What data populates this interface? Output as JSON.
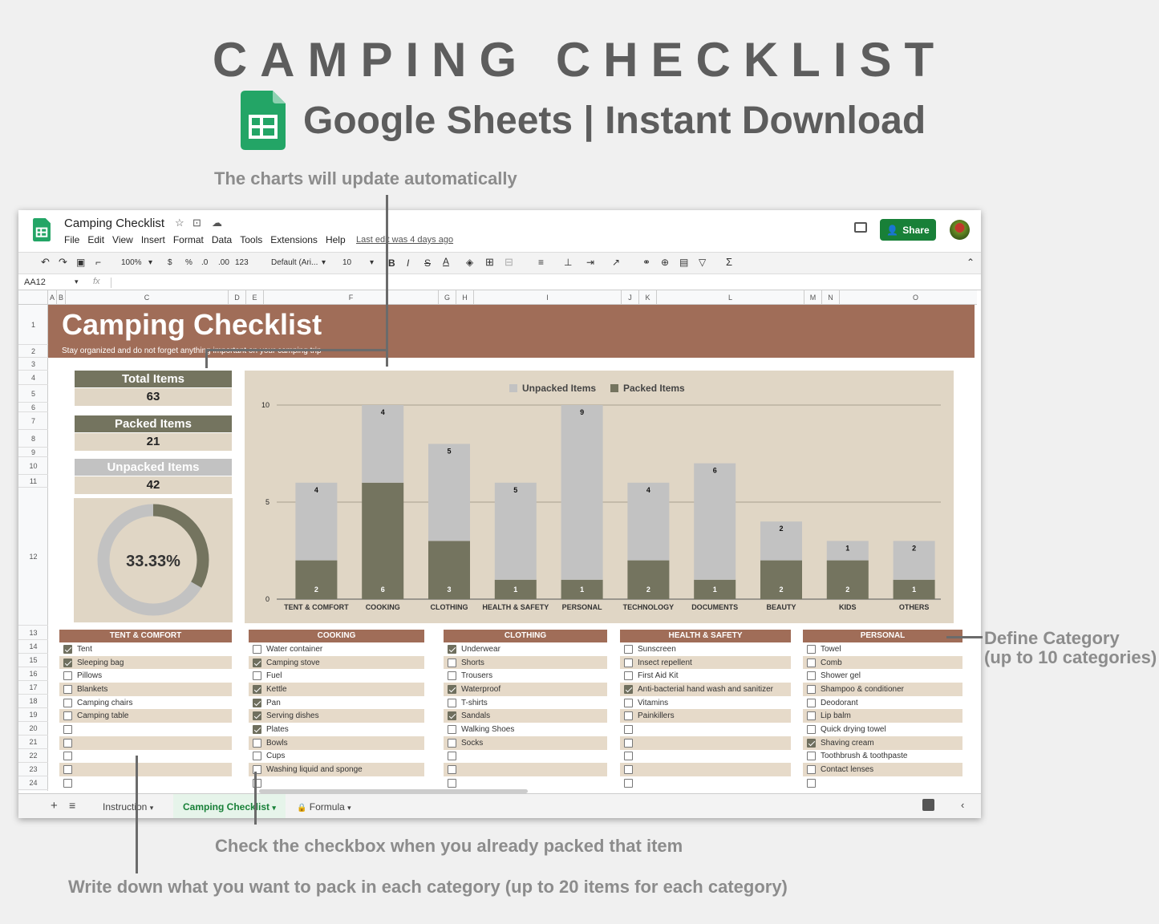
{
  "promo": {
    "title": "CAMPING CHECKLIST",
    "subtitle": "Google Sheets | Instant Download",
    "annotation_charts": "The charts will update automatically",
    "annotation_category": "Define Category\n(up to 10 categories)",
    "annotation_check": "Check the checkbox when you already packed that item",
    "annotation_write": "Write down what you want to pack in each category (up to 20 items for each category)"
  },
  "app": {
    "doc_title": "Camping Checklist",
    "menu": [
      "File",
      "Edit",
      "View",
      "Insert",
      "Format",
      "Data",
      "Tools",
      "Extensions",
      "Help"
    ],
    "last_edit": "Last edit was 4 days ago",
    "share_label": "Share",
    "toolbar": {
      "zoom": "100%",
      "currency": "$",
      "percent": "%",
      "dec_less": ".0",
      "dec_more": ".00",
      "format_more": "123",
      "font": "Default (Ari...",
      "font_size": "10",
      "bold": "B",
      "italic": "I",
      "strike": "S",
      "text_color": "A",
      "sum": "Σ"
    },
    "cell_ref": "AA12",
    "fx": "fx",
    "columns": [
      "A",
      "B",
      "C",
      "D",
      "E",
      "F",
      "G",
      "H",
      "I",
      "J",
      "K",
      "L",
      "M",
      "N",
      "O"
    ],
    "rows": [
      "1",
      "2",
      "3",
      "4",
      "5",
      "6",
      "7",
      "8",
      "9",
      "10",
      "11",
      "12",
      "13",
      "14",
      "15",
      "16",
      "17",
      "18",
      "19",
      "20",
      "21",
      "22",
      "23",
      "24"
    ],
    "tabs": {
      "add": "+",
      "list": "≡",
      "instruction": "Instruction",
      "camping": "Camping Checklist",
      "formula": "Formula"
    }
  },
  "sheet": {
    "title": "Camping Checklist",
    "subtitle": "Stay organized and do not forget anything important on your camping trip",
    "stats": {
      "total_label": "Total Items",
      "total_value": "63",
      "packed_label": "Packed Items",
      "packed_value": "21",
      "unpacked_label": "Unpacked Items",
      "unpacked_value": "42"
    },
    "donut_percent": "33.33%",
    "colors": {
      "banner": "#a06d58",
      "packed": "#74745f",
      "unpacked": "#c2c2c2",
      "panel": "#e0d6c5",
      "stat_total": "#74745f",
      "stat_unpacked": "#c2c2c2"
    },
    "categories": [
      {
        "name": "TENT & COMFORT",
        "items": [
          [
            "Tent",
            true
          ],
          [
            "Sleeping bag",
            true
          ],
          [
            "Pillows",
            false
          ],
          [
            "Blankets",
            false
          ],
          [
            "Camping chairs",
            false
          ],
          [
            "Camping table",
            false
          ],
          [
            "",
            false
          ],
          [
            "",
            false
          ],
          [
            "",
            false
          ],
          [
            "",
            false
          ],
          [
            "",
            false
          ]
        ]
      },
      {
        "name": "COOKING",
        "items": [
          [
            "Water container",
            false
          ],
          [
            "Camping stove",
            true
          ],
          [
            "Fuel",
            false
          ],
          [
            "Kettle",
            true
          ],
          [
            "Pan",
            true
          ],
          [
            "Serving dishes",
            true
          ],
          [
            "Plates",
            true
          ],
          [
            "Bowls",
            false
          ],
          [
            "Cups",
            false
          ],
          [
            "Washing liquid and sponge",
            false
          ],
          [
            "",
            false
          ]
        ]
      },
      {
        "name": "CLOTHING",
        "items": [
          [
            "Underwear",
            true
          ],
          [
            "Shorts",
            false
          ],
          [
            "Trousers",
            false
          ],
          [
            "Waterproof",
            true
          ],
          [
            "T-shirts",
            false
          ],
          [
            "Sandals",
            true
          ],
          [
            "Walking Shoes",
            false
          ],
          [
            "Socks",
            false
          ],
          [
            "",
            false
          ],
          [
            "",
            false
          ],
          [
            "",
            false
          ]
        ]
      },
      {
        "name": "HEALTH & SAFETY",
        "items": [
          [
            "Sunscreen",
            false
          ],
          [
            "Insect repellent",
            false
          ],
          [
            "First Aid Kit",
            false
          ],
          [
            "Anti-bacterial hand wash and sanitizer",
            true
          ],
          [
            "Vitamins",
            false
          ],
          [
            "Painkillers",
            false
          ],
          [
            "",
            false
          ],
          [
            "",
            false
          ],
          [
            "",
            false
          ],
          [
            "",
            false
          ],
          [
            "",
            false
          ]
        ]
      },
      {
        "name": "PERSONAL",
        "items": [
          [
            "Towel",
            false
          ],
          [
            "Comb",
            false
          ],
          [
            "Shower gel",
            false
          ],
          [
            "Shampoo & conditioner",
            false
          ],
          [
            "Deodorant",
            false
          ],
          [
            "Lip balm",
            false
          ],
          [
            "Quick drying towel",
            false
          ],
          [
            "Shaving cream",
            true
          ],
          [
            "Toothbrush & toothpaste",
            false
          ],
          [
            "Contact lenses",
            false
          ],
          [
            "",
            false
          ]
        ]
      }
    ]
  },
  "chart_data": [
    {
      "type": "bar",
      "stacked": true,
      "legend": "top",
      "categories": [
        "TENT & COMFORT",
        "COOKING",
        "CLOTHING",
        "HEALTH & SAFETY",
        "PERSONAL",
        "TECHNOLOGY",
        "DOCUMENTS",
        "BEAUTY",
        "KIDS",
        "OTHERS"
      ],
      "series": [
        {
          "name": "Packed Items",
          "values": [
            2,
            6,
            3,
            1,
            1,
            2,
            1,
            2,
            2,
            1
          ]
        },
        {
          "name": "Unpacked Items",
          "values": [
            4,
            4,
            5,
            5,
            9,
            4,
            6,
            2,
            1,
            2
          ]
        }
      ],
      "legend_order": [
        "Unpacked Items",
        "Packed Items"
      ],
      "y_ticks": [
        "0",
        "5",
        "10"
      ],
      "ylim": [
        0,
        10
      ],
      "grid": true
    },
    {
      "type": "pie",
      "donut": true,
      "values": [
        21,
        42
      ],
      "labels": [
        "Packed Items",
        "Unpacked Items"
      ],
      "center_label": "33.33%"
    }
  ]
}
